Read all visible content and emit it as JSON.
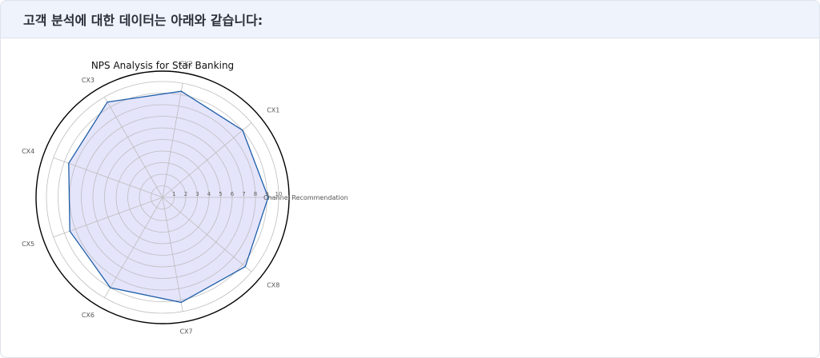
{
  "header": {
    "text": "고객 분석에 대한 데이터는 아래와 같습니다:"
  },
  "chart_data": {
    "type": "radar",
    "title": "NPS Analysis for Star Banking",
    "categories": [
      "Channel Recommendation",
      "CX1",
      "CX2",
      "CX3",
      "CX4",
      "CX5",
      "CX6",
      "CX7",
      "CX8"
    ],
    "series": [
      {
        "values": [
          9.1,
          9.0,
          9.3,
          9.5,
          8.6,
          8.5,
          9.0,
          9.2,
          9.3
        ]
      }
    ],
    "radial_range": [
      0,
      10
    ],
    "radial_ticks": [
      "1",
      "2",
      "3",
      "4",
      "5",
      "6",
      "7",
      "8",
      "9",
      "10"
    ],
    "grid": true,
    "colors": {
      "line": "#1f5fa8",
      "fill": "#e4e4fb",
      "grid": "#bdbdbd",
      "outer": "#000000"
    }
  }
}
